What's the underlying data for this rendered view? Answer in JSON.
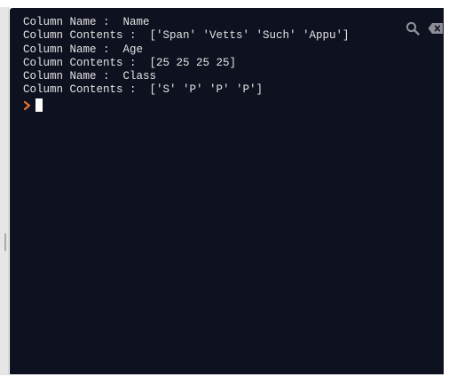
{
  "console": {
    "lines": [
      "Column Name :  Name",
      "Column Contents :  ['Span' 'Vetts' 'Such' 'Appu']",
      "Column Name :  Age",
      "Column Contents :  [25 25 25 25]",
      "Column Name :  Class",
      "Column Contents :  ['S' 'P' 'P' 'P']"
    ],
    "prompt_icon": "chevron-right-icon",
    "background": "#0e1120",
    "text_color": "#e3e3e3",
    "prompt_color": "#e8742a"
  },
  "toolbar": {
    "search_icon": "search-icon",
    "clear_icon": "clear-backspace-icon"
  }
}
